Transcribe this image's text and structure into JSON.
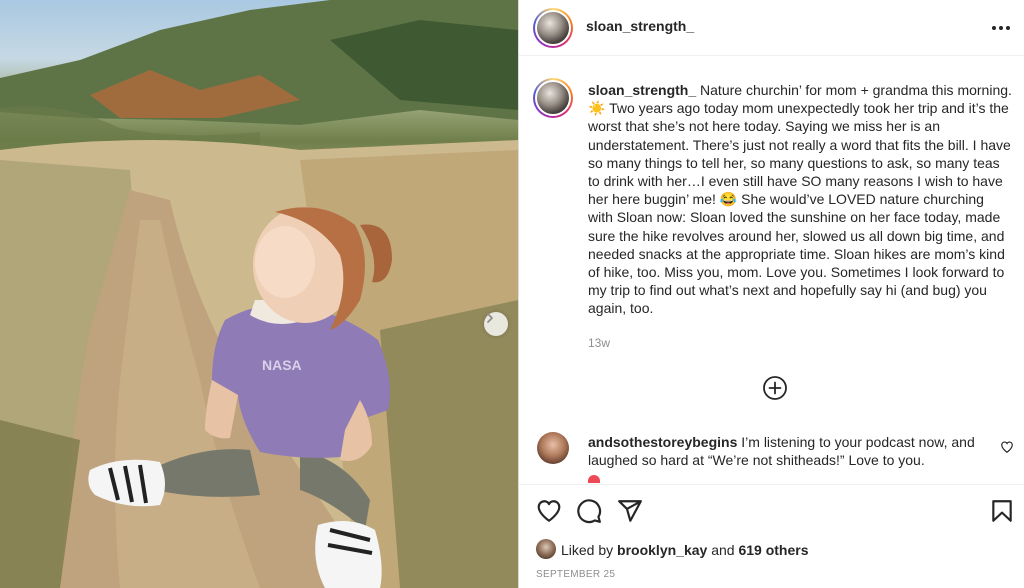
{
  "post": {
    "username": "sloan_strength_",
    "photo_alt": "Toddler in a NASA shirt sitting on a dirt hiking trail looking up at the sun"
  },
  "caption": {
    "username": "sloan_strength_",
    "text": " Nature churchin’ for mom + grandma this morning. ☀️ Two years ago today mom unexpectedly took her trip and it’s the worst that she’s not here today. Saying we miss her is an understatement. There’s just not really a word that fits the bill. I have so many things to tell her, so many questions to ask, so many teas to drink with her…I even still have SO many reasons I wish to have her here buggin’ me! 😂 She would’ve LOVED nature churching with Sloan now: Sloan loved the sunshine on her face today, made sure the hike revolves around her, slowed us all down big time, and needed snacks at the appropriate time. Sloan hikes are mom’s kind of hike, too. Miss you, mom. Love you. Sometimes I look forward to my trip to find out what’s next and hopefully say hi (and bug) you again, too.",
    "time_ago": "13w"
  },
  "comments": [
    {
      "username": "andsothestoreybegins",
      "text": " I’m listening to your podcast now, and laughed so hard at “We’re not shitheads!” Love to you."
    }
  ],
  "likes": {
    "prefix": "Liked by ",
    "user": "brooklyn_kay",
    "middle": " and ",
    "count_text": "619 others"
  },
  "date": "SEPTEMBER 25",
  "icons": {
    "more": "more-horizontal-icon",
    "next": "chevron-right-icon",
    "load_more": "plus-circle-icon",
    "like": "heart-icon",
    "comment": "comment-icon",
    "share": "paper-plane-icon",
    "save": "bookmark-icon"
  }
}
